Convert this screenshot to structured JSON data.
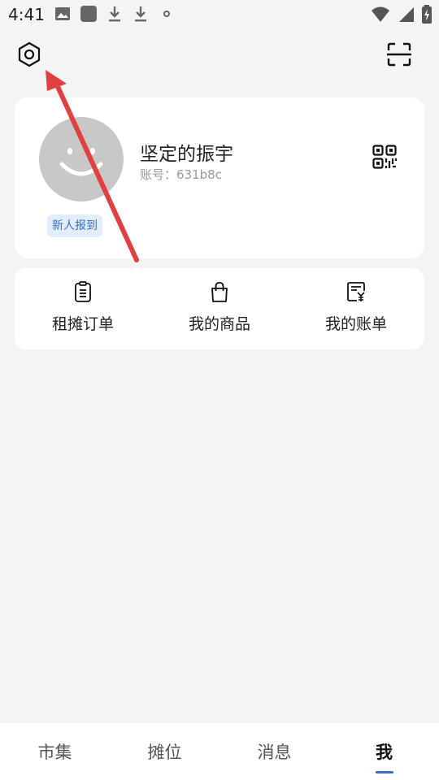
{
  "status_bar": {
    "time": "4:41",
    "left_icons": [
      "image-icon",
      "app-square-icon",
      "download-icon",
      "download-icon",
      "dot-icon"
    ],
    "right_icons": [
      "wifi-icon",
      "signal-icon",
      "battery-charging-icon"
    ]
  },
  "header": {
    "settings_icon": "hexagon-settings-icon",
    "scan_icon": "scan-frame-icon"
  },
  "profile": {
    "username": "坚定的振宇",
    "account": "账号：631b8c",
    "badge": "新人报到",
    "avatar_icon": "smiley-avatar-icon",
    "qr_icon": "qr-code-icon"
  },
  "quick_actions": [
    {
      "label": "租摊订单",
      "icon": "clipboard-icon"
    },
    {
      "label": "我的商品",
      "icon": "shopping-bag-icon"
    },
    {
      "label": "我的账单",
      "icon": "bill-yen-icon"
    }
  ],
  "bottom_nav": {
    "tabs": [
      {
        "label": "市集",
        "active": false
      },
      {
        "label": "摊位",
        "active": false
      },
      {
        "label": "消息",
        "active": false
      },
      {
        "label": "我",
        "active": true
      }
    ]
  },
  "colors": {
    "accent": "#3a6fc4",
    "arrow": "#e04040",
    "background": "#f4f4f4",
    "card": "#ffffff",
    "avatar": "#c8c8c8"
  }
}
